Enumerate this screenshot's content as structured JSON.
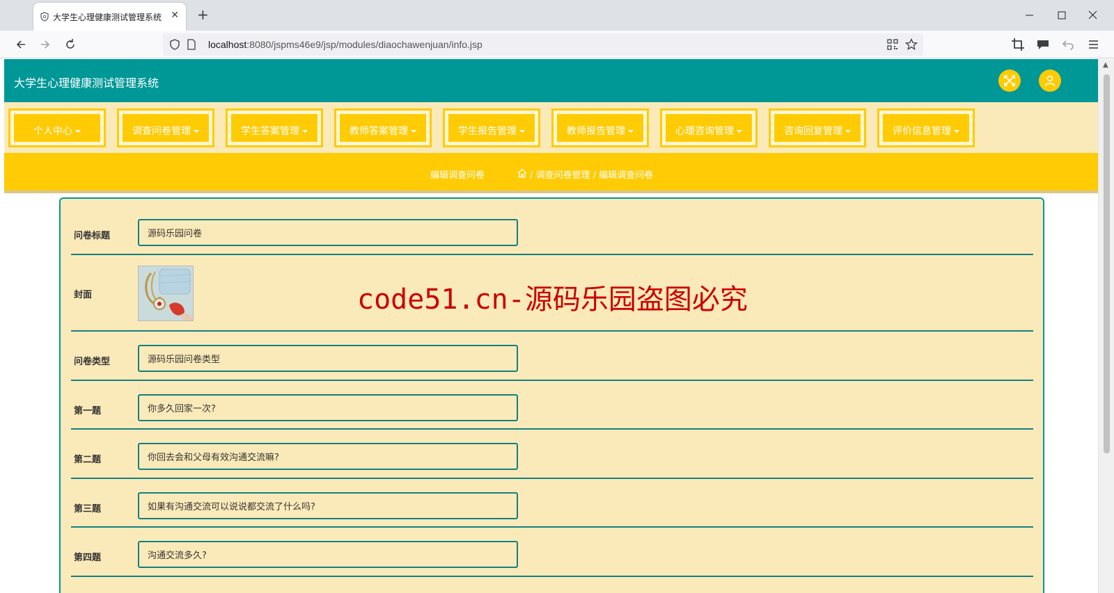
{
  "browser": {
    "tab_title": "大学生心理健康测试管理系统",
    "url_host": "localhost",
    "url_rest": ":8080/jspms46e9/jsp/modules/diaochawenjuan/info.jsp"
  },
  "header": {
    "title": "大学生心理健康测试管理系统"
  },
  "menu": [
    {
      "label": "个人中心"
    },
    {
      "label": "调查问卷管理"
    },
    {
      "label": "学生答案管理"
    },
    {
      "label": "教师答案管理"
    },
    {
      "label": "学生报告管理"
    },
    {
      "label": "教师报告管理"
    },
    {
      "label": "心理咨询管理"
    },
    {
      "label": "咨询回复管理"
    },
    {
      "label": "评价信息管理"
    }
  ],
  "breadcrumb": {
    "page_title": "编辑调查问卷",
    "path": "/ 调查问卷管理 / 编辑调查问卷"
  },
  "form": {
    "title_label": "问卷标题",
    "title_value": "源码乐园问卷",
    "cover_label": "封面",
    "type_label": "问卷类型",
    "type_value": "源码乐园问卷类型",
    "q1_label": "第一题",
    "q1_value": "你多久回家一次?",
    "q2_label": "第二题",
    "q2_value": "你回去会和父母有效沟通交流嘛?",
    "q3_label": "第三题",
    "q3_value": "如果有沟通交流可以说说都交流了什么吗?",
    "q4_label": "第四题",
    "q4_value": "沟通交流多久?"
  },
  "watermark": "code51.cn-源码乐园盗图必究",
  "colors": {
    "header": "#009797",
    "accent": "#ffcb05",
    "panel": "#fbeab9",
    "watermark": "#cc0000"
  }
}
